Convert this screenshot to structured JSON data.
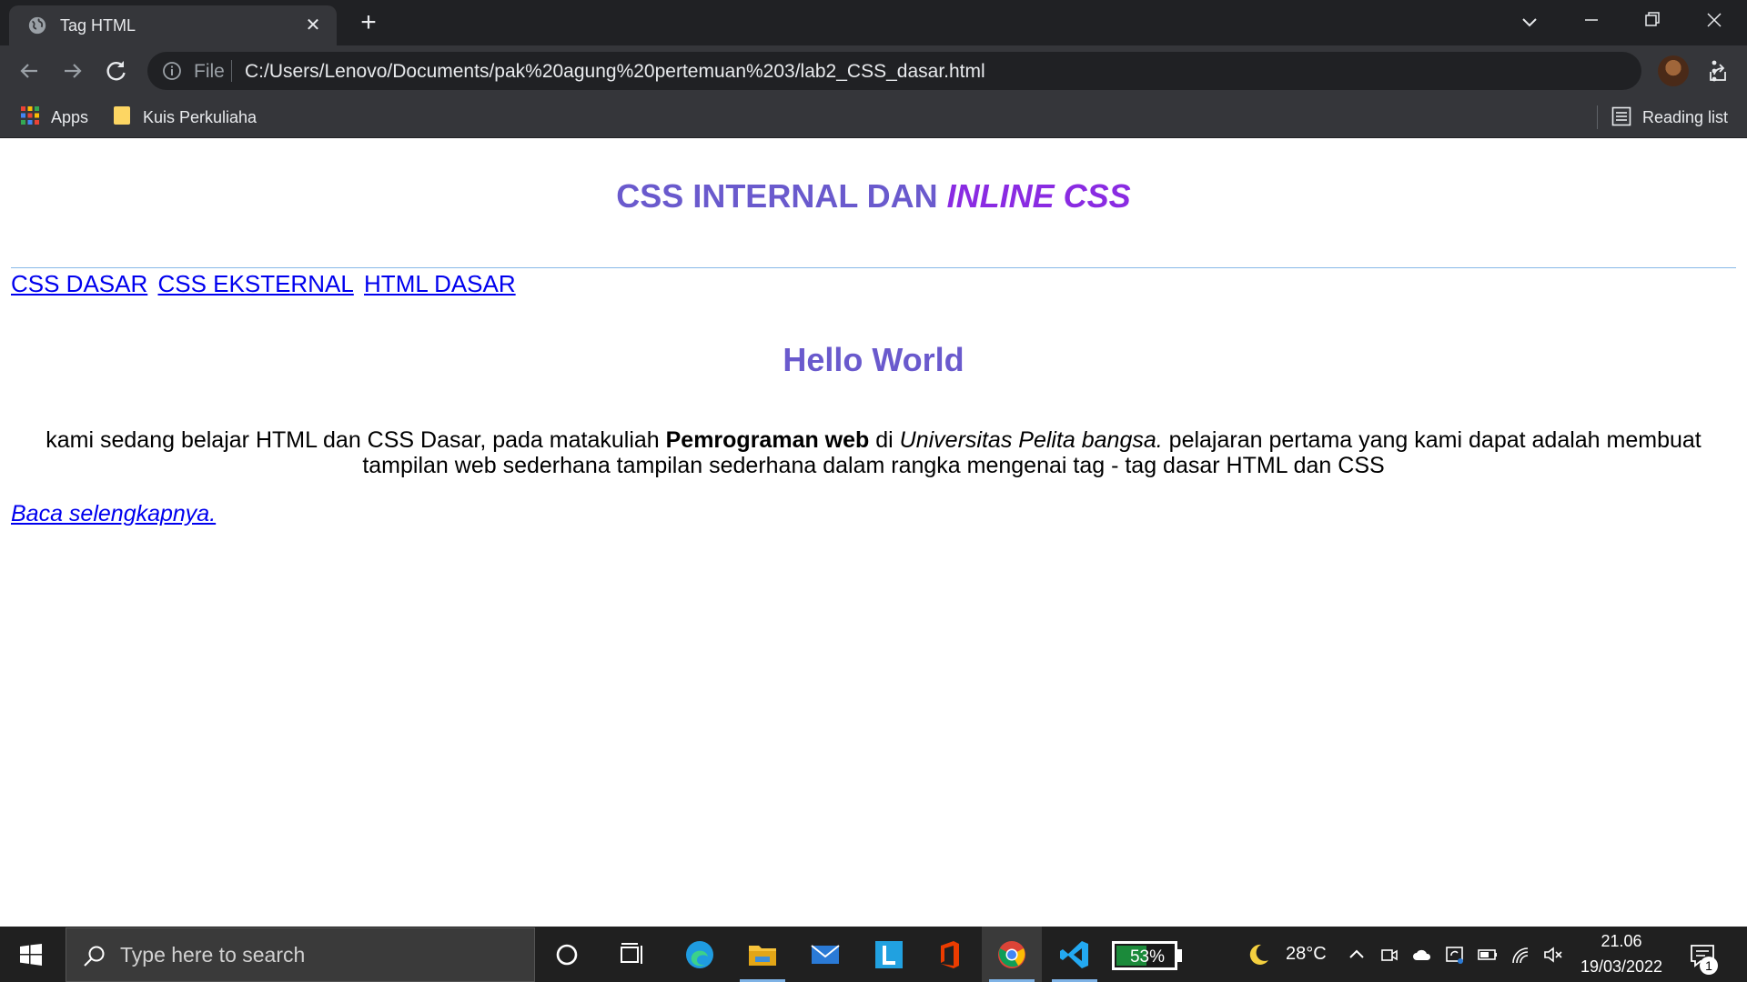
{
  "browser": {
    "tab": {
      "title": "Tag HTML"
    },
    "omnibox": {
      "scheme_label": "File",
      "url": "C:/Users/Lenovo/Documents/pak%20agung%20pertemuan%203/lab2_CSS_dasar.html"
    },
    "bookmarks": {
      "apps_label": "Apps",
      "folder_label": "Kuis Perkuliaha",
      "reading_list_label": "Reading list"
    }
  },
  "page": {
    "heading_part1": "CSS INTERNAL DAN ",
    "heading_part2": "INLINE CSS",
    "nav_links": [
      "CSS DASAR",
      "CSS EKSTERNAL",
      "HTML DASAR"
    ],
    "hello": "Hello World",
    "paragraph": {
      "text1": "kami sedang belajar HTML dan CSS Dasar, pada matakuliah ",
      "bold": "Pemrograman web",
      "text2": " di ",
      "italic": "Universitas Pelita bangsa.",
      "text3": " pelajaran pertama yang kami dapat adalah membuat tampilan web sederhana tampilan sederhana dalam rangka mengenai tag - tag dasar HTML dan CSS"
    },
    "read_more": "Baca selengkapnya.",
    "colors": {
      "heading": "#6a5acd",
      "heading_italic": "#8a2be2",
      "link": "#0000ee"
    }
  },
  "taskbar": {
    "search_placeholder": "Type here to search",
    "battery": {
      "level": 0.53,
      "label": "53%"
    },
    "temperature": "28°C",
    "time": "21.06",
    "date": "19/03/2022",
    "notification_count": "1",
    "apps": [
      "cortana-icon",
      "task-view-icon",
      "edge-icon",
      "file-explorer-icon",
      "mail-icon",
      "l-app-icon",
      "office-icon",
      "chrome-icon",
      "vscode-icon"
    ]
  }
}
